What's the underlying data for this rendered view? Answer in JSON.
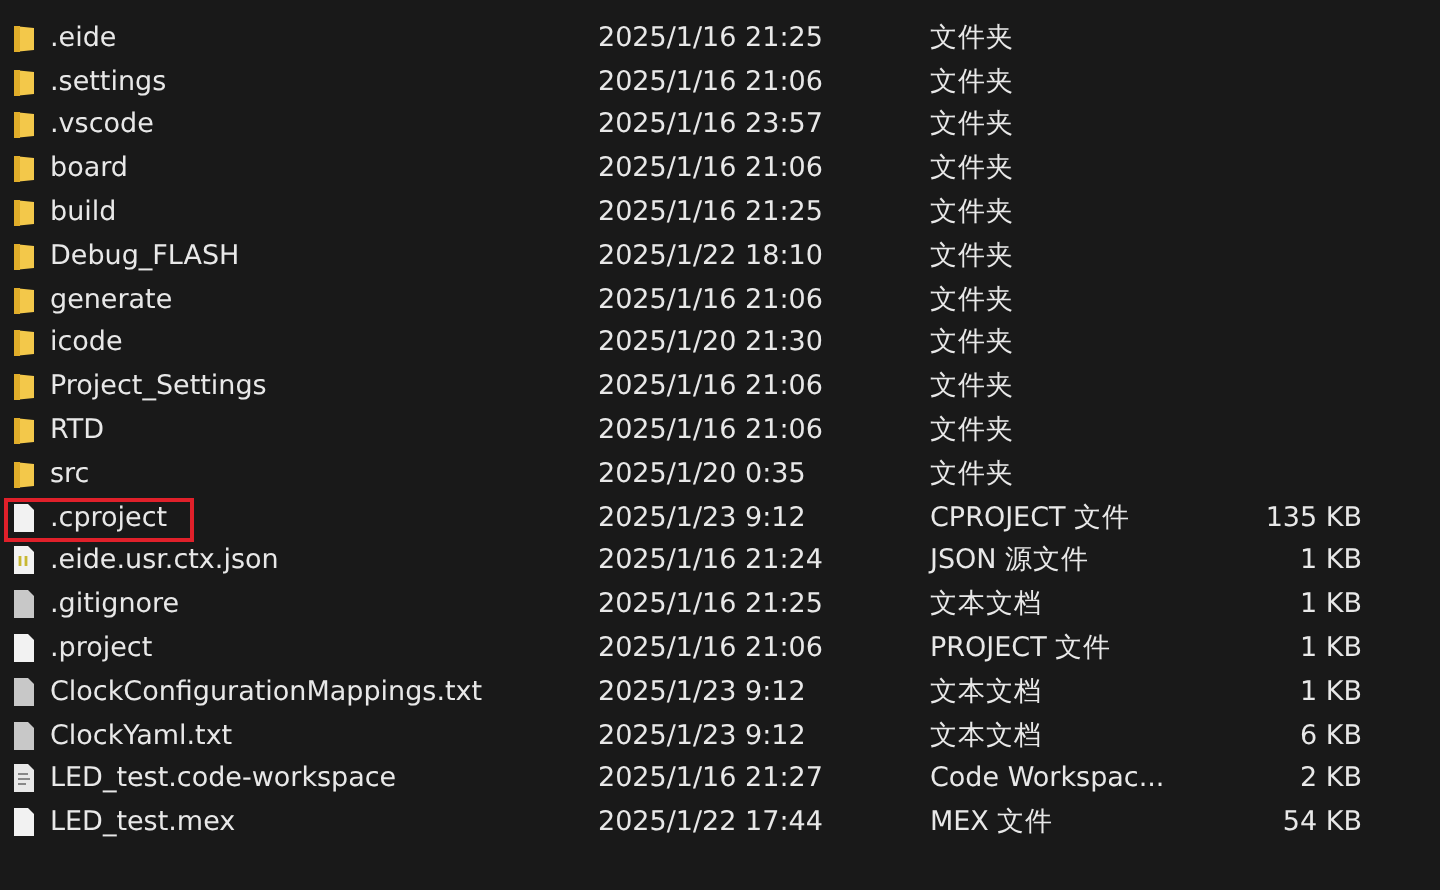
{
  "files": [
    {
      "kind": "folder",
      "name": ".eide",
      "date": "2025/1/16 21:25",
      "type": "文件夹",
      "highlighted": false
    },
    {
      "kind": "folder",
      "name": ".settings",
      "date": "2025/1/16 21:06",
      "type": "文件夹",
      "highlighted": false
    },
    {
      "kind": "folder",
      "name": ".vscode",
      "date": "2025/1/16 23:57",
      "type": "文件夹",
      "highlighted": false
    },
    {
      "kind": "folder",
      "name": "board",
      "date": "2025/1/16 21:06",
      "type": "文件夹",
      "highlighted": false
    },
    {
      "kind": "folder",
      "name": "build",
      "date": "2025/1/16 21:25",
      "type": "文件夹",
      "highlighted": false
    },
    {
      "kind": "folder",
      "name": "Debug_FLASH",
      "date": "2025/1/22 18:10",
      "type": "文件夹",
      "highlighted": false
    },
    {
      "kind": "folder",
      "name": "generate",
      "date": "2025/1/16 21:06",
      "type": "文件夹",
      "highlighted": false
    },
    {
      "kind": "folder",
      "name": "icode",
      "date": "2025/1/20 21:30",
      "type": "文件夹",
      "highlighted": false
    },
    {
      "kind": "folder",
      "name": "Project_Settings",
      "date": "2025/1/16 21:06",
      "type": "文件夹",
      "highlighted": false
    },
    {
      "kind": "folder",
      "name": "RTD",
      "date": "2025/1/16 21:06",
      "type": "文件夹",
      "highlighted": false
    },
    {
      "kind": "folder",
      "name": "src",
      "date": "2025/1/20 0:35",
      "type": "文件夹",
      "highlighted": false
    },
    {
      "kind": "file",
      "name": ".cproject",
      "date": "2025/1/23 9:12",
      "type": "CPROJECT 文件",
      "size": "135 KB",
      "highlighted": true
    },
    {
      "kind": "json",
      "name": ".eide.usr.ctx.json",
      "date": "2025/1/16 21:24",
      "type": "JSON 源文件",
      "size": "1 KB",
      "highlighted": false
    },
    {
      "kind": "text",
      "name": ".gitignore",
      "date": "2025/1/16 21:25",
      "type": "文本文档",
      "size": "1 KB",
      "highlighted": false
    },
    {
      "kind": "file",
      "name": ".project",
      "date": "2025/1/16 21:06",
      "type": "PROJECT 文件",
      "size": "1 KB",
      "highlighted": false
    },
    {
      "kind": "text",
      "name": "ClockConfigurationMappings.txt",
      "date": "2025/1/23 9:12",
      "type": "文本文档",
      "size": "1 KB",
      "highlighted": false
    },
    {
      "kind": "text",
      "name": "ClockYaml.txt",
      "date": "2025/1/23 9:12",
      "type": "文本文档",
      "size": "6 KB",
      "highlighted": false
    },
    {
      "kind": "lines",
      "name": "LED_test.code-workspace",
      "date": "2025/1/16 21:27",
      "type": "Code Workspac...",
      "size": "2 KB",
      "highlighted": false
    },
    {
      "kind": "file",
      "name": "LED_test.mex",
      "date": "2025/1/22 17:44",
      "type": "MEX 文件",
      "size": "54 KB",
      "highlighted": false
    }
  ]
}
